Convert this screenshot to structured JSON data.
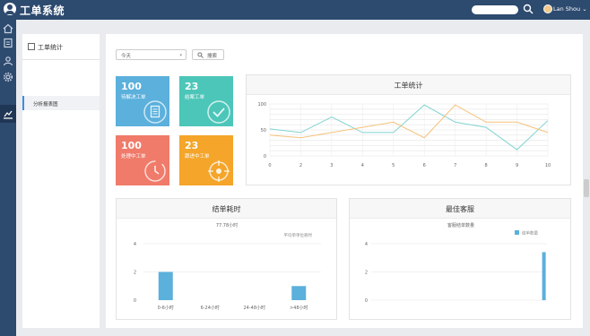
{
  "app": {
    "title": "工单系统"
  },
  "header": {
    "user_name": "Lan Shou ⌄",
    "search_placeholder": ""
  },
  "sidebar": {
    "title": "工单统计",
    "items": [
      {
        "label": "分析报表图"
      }
    ]
  },
  "filter": {
    "select_value": "今天",
    "search_label": "搜索"
  },
  "tiles": [
    {
      "value": "100",
      "label": "待解决工单",
      "color": "#5bb0dc",
      "icon": "document-icon"
    },
    {
      "value": "23",
      "label": "结案工单",
      "color": "#4cc6b9",
      "icon": "check-circle-icon"
    },
    {
      "value": "100",
      "label": "处理中工单",
      "color": "#f07b6a",
      "icon": "clock-icon"
    },
    {
      "value": "23",
      "label": "跟进中工单",
      "color": "#f4a52a",
      "icon": "target-icon"
    }
  ],
  "panels": {
    "stats_title": "工单统计",
    "time_title": "结单耗时",
    "best_title": "最佳客服"
  },
  "chart_data": [
    {
      "type": "line",
      "x": [
        0,
        1,
        2,
        3,
        4,
        5,
        6,
        7,
        8,
        9,
        10
      ],
      "xticks": [
        "0",
        "2",
        "3",
        "4",
        "5",
        "6",
        "7",
        "8",
        "9",
        "10"
      ],
      "ylim": [
        0,
        100
      ],
      "yticks": [
        "0",
        "50",
        "100"
      ],
      "series": [
        {
          "color": "#7fd4d0",
          "values": [
            52,
            45,
            75,
            45,
            45,
            98,
            65,
            55,
            12,
            68
          ]
        },
        {
          "color": "#f5c27a",
          "values": [
            40,
            35,
            45,
            55,
            65,
            35,
            98,
            65,
            65,
            45
          ]
        }
      ]
    },
    {
      "type": "bar",
      "title": "77.78小时",
      "legend": "平均单单位耗时",
      "categories": [
        "0-6小时",
        "6-24小时",
        "24-48小时",
        ">48小时"
      ],
      "values": [
        2,
        0,
        0,
        1
      ],
      "ylim": [
        0,
        4
      ],
      "yticks": [
        "0",
        "2",
        "4"
      ],
      "color": "#5bb0dc"
    },
    {
      "type": "bar",
      "title": "客服结单数量",
      "legend": "结单数量",
      "values": [
        0,
        0,
        0,
        0,
        0,
        0,
        0,
        0,
        0,
        0,
        0,
        0,
        0,
        0,
        0,
        0,
        0,
        0,
        0,
        0,
        0,
        0,
        0,
        0,
        0,
        0,
        0,
        0,
        3.4
      ],
      "ylim": [
        0,
        4
      ],
      "yticks": [
        "0",
        "2",
        "4"
      ],
      "color": "#5bb0dc"
    }
  ]
}
